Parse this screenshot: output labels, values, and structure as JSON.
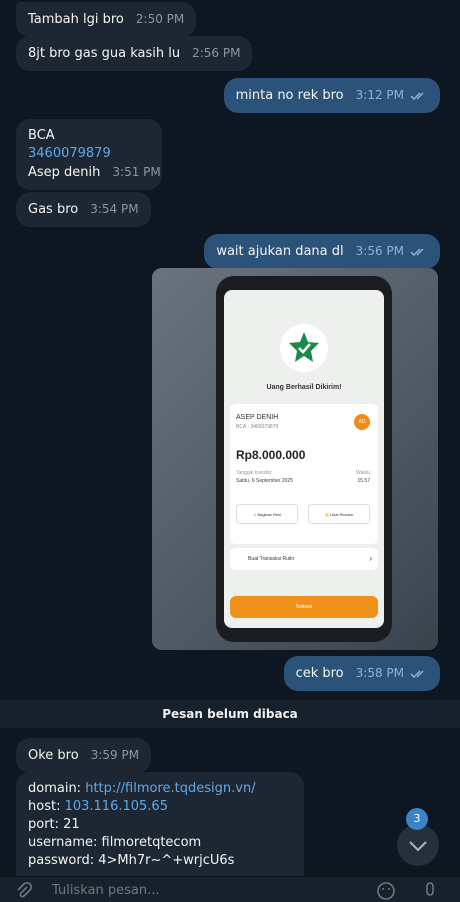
{
  "messages": {
    "m1": {
      "text": "Tambah lgi bro",
      "time": "2:50 PM"
    },
    "m2": {
      "text": "8jt bro gas gua kasih lu",
      "time": "2:56 PM"
    },
    "m3": {
      "text": "minta no rek bro",
      "time": "3:12 PM"
    },
    "m4": {
      "bank": "BCA",
      "account": "3460079879",
      "name": "Asep denih",
      "time": "3:51 PM"
    },
    "m5": {
      "text": "Gas bro",
      "time": "3:54 PM"
    },
    "m6": {
      "text": "wait ajukan dana dl",
      "time": "3:56 PM"
    },
    "m7": {
      "text": "cek bro",
      "time": "3:58 PM"
    },
    "m8": {
      "text": "Oke bro",
      "time": "3:59 PM"
    },
    "m9": {
      "domain_label": "domain:",
      "domain": "http://filmore.tqdesign.vn/",
      "host_label": "host:",
      "host": "103.116.105.65",
      "port": "port: 21",
      "username": "username: filmoretqtecom",
      "password": "password: 4>Mh7r~^+wrjcU6s"
    }
  },
  "photo": {
    "title": "Uang Berhasil Dikirim!",
    "recipient": "ASEP DENIH",
    "recipient_sub": "BCA - 3460079879",
    "initials": "AD",
    "amount": "Rp8.000.000",
    "date_label": "Tanggal transfer",
    "date": "Sabtu, 6 September 2025",
    "time_label": "Waktu",
    "time": "15.57",
    "share": "Bagikan Resi",
    "details": "Lihat Rincian",
    "routine": "Buat Transaksi Rutin",
    "done": "Selesai"
  },
  "divider": "Pesan belum dibaca",
  "unread_count": "3",
  "composer": {
    "placeholder": "Tuliskan pesan..."
  },
  "colors": {
    "incoming": "#1d2733",
    "outgoing": "#2b5278",
    "background": "#0e1621",
    "link": "#62a8e6",
    "accent": "#3b84c4"
  }
}
